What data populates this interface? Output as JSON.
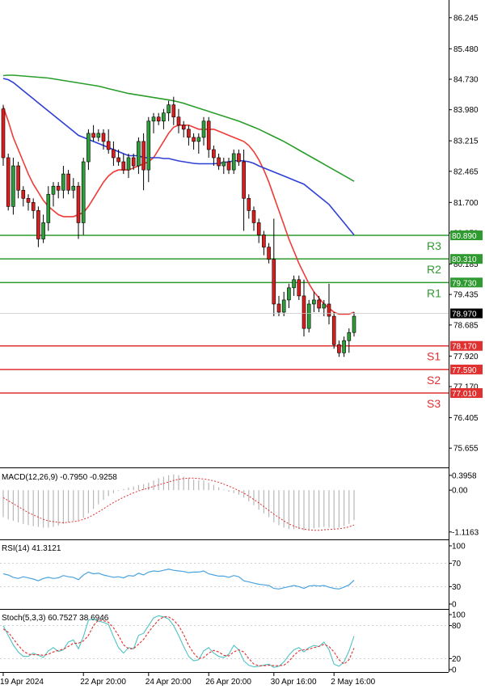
{
  "colors": {
    "candle": "#000000",
    "up_fill": "#2e9e3a",
    "down_fill": "#d81f1f",
    "sma_fast": "#ef3b36",
    "sma_mid": "#2f3fd6",
    "sma_slow": "#2a9d2a",
    "resistance": "#2f9a2f",
    "support": "#e03030",
    "price_box": "#000000",
    "macd_hist": "#b8b8b8",
    "macd_signal": "#e03030",
    "rsi_line": "#4aa3df",
    "stoch_main": "#4fc3c3",
    "stoch_signal": "#e03030"
  },
  "chart_data": [
    {
      "type": "candlestick",
      "title": "",
      "ylim": [
        75.3,
        86.6
      ],
      "y_ticks": [
        "86.245",
        "85.480",
        "84.730",
        "83.980",
        "83.215",
        "82.465",
        "81.700",
        "80.950",
        "80.185",
        "79.435",
        "78.685",
        "77.920",
        "77.170",
        "76.405",
        "75.655"
      ],
      "x_tick_labels": [
        "19 Apr 2024",
        "22 Apr 20:00",
        "24 Apr 20:00",
        "26 Apr 20:00",
        "30 Apr 16:00",
        "2 May 16:00"
      ],
      "x_tick_index": [
        0,
        16,
        29,
        41,
        54,
        66
      ],
      "current_price": "78.970",
      "candles": [
        {
          "o": 84.0,
          "h": 84.1,
          "l": 82.6,
          "c": 82.8
        },
        {
          "o": 82.8,
          "h": 82.9,
          "l": 81.5,
          "c": 81.6
        },
        {
          "o": 81.6,
          "h": 82.8,
          "l": 81.4,
          "c": 82.6
        },
        {
          "o": 82.6,
          "h": 82.7,
          "l": 81.8,
          "c": 82.0
        },
        {
          "o": 82.0,
          "h": 82.1,
          "l": 81.6,
          "c": 81.8
        },
        {
          "o": 81.8,
          "h": 81.9,
          "l": 81.5,
          "c": 81.7
        },
        {
          "o": 81.7,
          "h": 81.8,
          "l": 81.3,
          "c": 81.5
        },
        {
          "o": 81.5,
          "h": 81.6,
          "l": 80.6,
          "c": 80.8
        },
        {
          "o": 80.8,
          "h": 81.4,
          "l": 80.7,
          "c": 81.2
        },
        {
          "o": 81.2,
          "h": 82.1,
          "l": 81.0,
          "c": 81.9
        },
        {
          "o": 81.9,
          "h": 82.2,
          "l": 81.6,
          "c": 82.1
        },
        {
          "o": 82.1,
          "h": 82.2,
          "l": 81.8,
          "c": 82.0
        },
        {
          "o": 82.0,
          "h": 82.6,
          "l": 81.8,
          "c": 82.4
        },
        {
          "o": 82.4,
          "h": 82.5,
          "l": 81.9,
          "c": 82.0
        },
        {
          "o": 82.0,
          "h": 82.3,
          "l": 81.8,
          "c": 82.1
        },
        {
          "o": 82.1,
          "h": 82.2,
          "l": 80.8,
          "c": 81.2
        },
        {
          "o": 81.2,
          "h": 82.8,
          "l": 80.9,
          "c": 82.7
        },
        {
          "o": 82.7,
          "h": 83.5,
          "l": 82.5,
          "c": 83.4
        },
        {
          "o": 83.4,
          "h": 83.6,
          "l": 83.2,
          "c": 83.3
        },
        {
          "o": 83.3,
          "h": 83.5,
          "l": 83.2,
          "c": 83.4
        },
        {
          "o": 83.4,
          "h": 83.5,
          "l": 83.0,
          "c": 83.2
        },
        {
          "o": 83.2,
          "h": 83.5,
          "l": 82.9,
          "c": 83.0
        },
        {
          "o": 83.0,
          "h": 83.2,
          "l": 82.6,
          "c": 82.8
        },
        {
          "o": 82.8,
          "h": 83.0,
          "l": 82.6,
          "c": 82.7
        },
        {
          "o": 82.7,
          "h": 82.9,
          "l": 82.4,
          "c": 82.5
        },
        {
          "o": 82.5,
          "h": 82.9,
          "l": 82.3,
          "c": 82.8
        },
        {
          "o": 82.8,
          "h": 82.9,
          "l": 82.5,
          "c": 82.6
        },
        {
          "o": 82.6,
          "h": 83.3,
          "l": 82.4,
          "c": 83.2
        },
        {
          "o": 83.2,
          "h": 83.4,
          "l": 82.0,
          "c": 82.5
        },
        {
          "o": 82.5,
          "h": 83.8,
          "l": 82.2,
          "c": 83.7
        },
        {
          "o": 83.7,
          "h": 83.9,
          "l": 83.4,
          "c": 83.8
        },
        {
          "o": 83.8,
          "h": 83.9,
          "l": 83.6,
          "c": 83.7
        },
        {
          "o": 83.7,
          "h": 84.0,
          "l": 83.5,
          "c": 83.9
        },
        {
          "o": 83.9,
          "h": 84.2,
          "l": 83.7,
          "c": 84.1
        },
        {
          "o": 84.1,
          "h": 84.3,
          "l": 83.6,
          "c": 83.8
        },
        {
          "o": 83.8,
          "h": 84.0,
          "l": 83.4,
          "c": 83.6
        },
        {
          "o": 83.6,
          "h": 83.7,
          "l": 83.3,
          "c": 83.5
        },
        {
          "o": 83.5,
          "h": 83.6,
          "l": 83.1,
          "c": 83.3
        },
        {
          "o": 83.3,
          "h": 83.4,
          "l": 83.0,
          "c": 83.2
        },
        {
          "o": 83.2,
          "h": 83.4,
          "l": 82.9,
          "c": 83.3
        },
        {
          "o": 83.3,
          "h": 83.8,
          "l": 83.1,
          "c": 83.7
        },
        {
          "o": 83.7,
          "h": 83.8,
          "l": 82.8,
          "c": 83.0
        },
        {
          "o": 83.0,
          "h": 83.1,
          "l": 82.6,
          "c": 82.8
        },
        {
          "o": 82.8,
          "h": 82.9,
          "l": 82.5,
          "c": 82.6
        },
        {
          "o": 82.6,
          "h": 82.8,
          "l": 82.4,
          "c": 82.7
        },
        {
          "o": 82.7,
          "h": 82.8,
          "l": 82.4,
          "c": 82.5
        },
        {
          "o": 82.5,
          "h": 83.0,
          "l": 82.4,
          "c": 82.9
        },
        {
          "o": 82.9,
          "h": 83.0,
          "l": 82.6,
          "c": 82.7
        },
        {
          "o": 82.7,
          "h": 83.0,
          "l": 81.0,
          "c": 81.8
        },
        {
          "o": 81.8,
          "h": 81.9,
          "l": 81.3,
          "c": 81.5
        },
        {
          "o": 81.5,
          "h": 81.6,
          "l": 81.0,
          "c": 81.2
        },
        {
          "o": 81.2,
          "h": 81.3,
          "l": 80.7,
          "c": 80.9
        },
        {
          "o": 80.9,
          "h": 81.0,
          "l": 80.4,
          "c": 80.6
        },
        {
          "o": 80.6,
          "h": 80.7,
          "l": 80.2,
          "c": 80.3
        },
        {
          "o": 80.3,
          "h": 81.3,
          "l": 78.9,
          "c": 79.2
        },
        {
          "o": 79.2,
          "h": 79.4,
          "l": 78.9,
          "c": 79.0
        },
        {
          "o": 79.0,
          "h": 79.5,
          "l": 78.9,
          "c": 79.3
        },
        {
          "o": 79.3,
          "h": 79.7,
          "l": 79.1,
          "c": 79.6
        },
        {
          "o": 79.6,
          "h": 79.9,
          "l": 79.4,
          "c": 79.8
        },
        {
          "o": 79.8,
          "h": 79.9,
          "l": 79.3,
          "c": 79.4
        },
        {
          "o": 79.4,
          "h": 79.8,
          "l": 78.4,
          "c": 78.6
        },
        {
          "o": 78.6,
          "h": 79.3,
          "l": 78.5,
          "c": 79.2
        },
        {
          "o": 79.2,
          "h": 79.5,
          "l": 79.0,
          "c": 79.3
        },
        {
          "o": 79.3,
          "h": 79.4,
          "l": 79.0,
          "c": 79.1
        },
        {
          "o": 79.1,
          "h": 79.3,
          "l": 78.9,
          "c": 79.2
        },
        {
          "o": 79.2,
          "h": 79.7,
          "l": 78.7,
          "c": 78.9
        },
        {
          "o": 78.9,
          "h": 79.0,
          "l": 78.1,
          "c": 78.2
        },
        {
          "o": 78.2,
          "h": 78.3,
          "l": 77.9,
          "c": 78.0
        },
        {
          "o": 78.0,
          "h": 78.4,
          "l": 77.9,
          "c": 78.3
        },
        {
          "o": 78.3,
          "h": 78.6,
          "l": 78.0,
          "c": 78.5
        },
        {
          "o": 78.5,
          "h": 79.0,
          "l": 78.4,
          "c": 78.9
        }
      ],
      "series": [
        {
          "values": [
            84.05,
            83.7,
            83.3,
            83.0,
            82.7,
            82.4,
            82.15,
            81.95,
            81.75,
            81.6,
            81.5,
            81.4,
            81.35,
            81.35,
            81.35,
            81.4,
            81.45,
            81.6,
            81.8,
            82.0,
            82.2,
            82.35,
            82.45,
            82.5,
            82.5,
            82.5,
            82.55,
            82.6,
            82.65,
            82.7,
            82.8,
            83.0,
            83.2,
            83.4,
            83.55,
            83.6,
            83.6,
            83.6,
            83.55,
            83.5,
            83.5,
            83.5,
            83.5,
            83.45,
            83.4,
            83.35,
            83.3,
            83.25,
            83.2,
            83.1,
            82.95,
            82.75,
            82.5,
            82.2,
            81.85,
            81.5,
            81.15,
            80.8,
            80.5,
            80.2,
            79.95,
            79.7,
            79.5,
            79.35,
            79.2,
            79.1,
            79.0,
            78.95,
            78.95,
            78.95,
            79.0
          ]
        },
        {
          "values": [
            84.75,
            84.72,
            84.65,
            84.55,
            84.45,
            84.35,
            84.25,
            84.15,
            84.05,
            83.95,
            83.85,
            83.75,
            83.65,
            83.55,
            83.45,
            83.35,
            83.3,
            83.25,
            83.2,
            83.15,
            83.1,
            83.05,
            83.0,
            82.95,
            82.9,
            82.85,
            82.85,
            82.85,
            82.8,
            82.8,
            82.8,
            82.8,
            82.78,
            82.78,
            82.75,
            82.72,
            82.7,
            82.68,
            82.66,
            82.65,
            82.65,
            82.65,
            82.65,
            82.66,
            82.68,
            82.7,
            82.72,
            82.73,
            82.72,
            82.7,
            82.66,
            82.6,
            82.55,
            82.5,
            82.45,
            82.4,
            82.35,
            82.3,
            82.25,
            82.2,
            82.15,
            82.05,
            81.95,
            81.85,
            81.75,
            81.65,
            81.5,
            81.35,
            81.2,
            81.05,
            80.9
          ]
        },
        {
          "values": [
            84.82,
            84.83,
            84.83,
            84.82,
            84.81,
            84.8,
            84.79,
            84.78,
            84.77,
            84.76,
            84.74,
            84.72,
            84.7,
            84.68,
            84.66,
            84.64,
            84.62,
            84.6,
            84.58,
            84.56,
            84.53,
            84.5,
            84.47,
            84.44,
            84.41,
            84.38,
            84.36,
            84.34,
            84.32,
            84.3,
            84.28,
            84.26,
            84.24,
            84.22,
            84.2,
            84.17,
            84.14,
            84.1,
            84.06,
            84.02,
            83.98,
            83.94,
            83.9,
            83.86,
            83.82,
            83.78,
            83.74,
            83.7,
            83.65,
            83.6,
            83.55,
            83.5,
            83.44,
            83.38,
            83.32,
            83.26,
            83.2,
            83.13,
            83.06,
            82.99,
            82.92,
            82.85,
            82.78,
            82.71,
            82.64,
            82.57,
            82.5,
            82.43,
            82.36,
            82.29,
            82.22
          ]
        }
      ],
      "levels": [
        {
          "label": "R3",
          "value": 80.89,
          "value_label": "80.890",
          "kind": "resistance"
        },
        {
          "label": "R2",
          "value": 80.31,
          "value_label": "80.310",
          "kind": "resistance"
        },
        {
          "label": "R1",
          "value": 79.73,
          "value_label": "79.730",
          "kind": "resistance"
        },
        {
          "label": "S1",
          "value": 78.17,
          "value_label": "78.170",
          "kind": "support"
        },
        {
          "label": "S2",
          "value": 77.59,
          "value_label": "77.590",
          "kind": "support"
        },
        {
          "label": "S3",
          "value": 77.01,
          "value_label": "77.010",
          "kind": "support"
        }
      ]
    },
    {
      "type": "bar",
      "title": "MACD(12,26,9) -0.7950 -0.9258",
      "ylim": [
        -1.25,
        0.5
      ],
      "y_ticks": [
        "0.3958",
        "0.00",
        "-1.1163"
      ],
      "y_tick_values": [
        0.3958,
        0.0,
        -1.1163
      ],
      "histogram": [
        -0.72,
        -0.78,
        -0.82,
        -0.86,
        -0.9,
        -0.93,
        -0.96,
        -0.98,
        -1.0,
        -1.0,
        -0.98,
        -0.95,
        -0.9,
        -0.86,
        -0.82,
        -0.8,
        -0.74,
        -0.62,
        -0.5,
        -0.38,
        -0.26,
        -0.16,
        -0.08,
        -0.02,
        0.03,
        0.07,
        0.1,
        0.14,
        0.16,
        0.2,
        0.26,
        0.32,
        0.36,
        0.4,
        0.42,
        0.4,
        0.36,
        0.32,
        0.28,
        0.26,
        0.26,
        0.2,
        0.14,
        0.08,
        0.02,
        -0.04,
        -0.08,
        -0.12,
        -0.2,
        -0.3,
        -0.4,
        -0.52,
        -0.62,
        -0.72,
        -0.86,
        -0.94,
        -1.0,
        -1.04,
        -1.04,
        -1.04,
        -1.08,
        -1.04,
        -1.02,
        -1.0,
        -0.98,
        -1.0,
        -1.02,
        -1.0,
        -0.96,
        -0.9,
        -0.8
      ],
      "signal": [
        -0.2,
        -0.28,
        -0.36,
        -0.44,
        -0.52,
        -0.6,
        -0.66,
        -0.72,
        -0.78,
        -0.82,
        -0.84,
        -0.86,
        -0.87,
        -0.86,
        -0.84,
        -0.82,
        -0.78,
        -0.73,
        -0.66,
        -0.58,
        -0.5,
        -0.41,
        -0.33,
        -0.26,
        -0.19,
        -0.13,
        -0.07,
        -0.02,
        0.02,
        0.06,
        0.1,
        0.14,
        0.18,
        0.22,
        0.26,
        0.29,
        0.31,
        0.32,
        0.32,
        0.31,
        0.3,
        0.28,
        0.25,
        0.21,
        0.16,
        0.11,
        0.05,
        -0.01,
        -0.08,
        -0.16,
        -0.25,
        -0.34,
        -0.44,
        -0.54,
        -0.64,
        -0.73,
        -0.82,
        -0.9,
        -0.96,
        -1.01,
        -1.04,
        -1.06,
        -1.07,
        -1.07,
        -1.06,
        -1.05,
        -1.04,
        -1.03,
        -1.01,
        -0.98,
        -0.93
      ]
    },
    {
      "type": "line",
      "title": "RSI(14) 41.3121",
      "ylim": [
        0,
        100
      ],
      "y_ticks": [
        "100",
        "70",
        "30",
        "0"
      ],
      "y_tick_values": [
        100,
        70,
        30,
        0
      ],
      "values": [
        52,
        50,
        46,
        44,
        47,
        45,
        43,
        40,
        44,
        46,
        44,
        45,
        49,
        47,
        46,
        42,
        50,
        55,
        52,
        53,
        50,
        48,
        46,
        47,
        45,
        49,
        48,
        53,
        50,
        55,
        57,
        56,
        58,
        60,
        58,
        57,
        56,
        54,
        55,
        55,
        57,
        52,
        50,
        48,
        48,
        46,
        49,
        47,
        40,
        38,
        36,
        34,
        33,
        32,
        27,
        26,
        28,
        30,
        32,
        30,
        27,
        31,
        32,
        31,
        32,
        29,
        27,
        26,
        29,
        33,
        41
      ]
    },
    {
      "type": "line",
      "title": "Stoch(5,3,3) 60.7527 38.6946",
      "ylim": [
        0,
        100
      ],
      "y_ticks": [
        "100",
        "80",
        "20",
        "0"
      ],
      "y_tick_values": [
        100,
        80,
        20,
        0
      ],
      "series": [
        {
          "values": [
            80,
            62,
            45,
            32,
            24,
            24,
            30,
            26,
            22,
            34,
            40,
            33,
            36,
            50,
            54,
            38,
            60,
            90,
            92,
            88,
            86,
            82,
            60,
            40,
            30,
            40,
            38,
            62,
            66,
            80,
            94,
            98,
            96,
            92,
            80,
            62,
            42,
            24,
            16,
            18,
            34,
            40,
            30,
            24,
            22,
            28,
            44,
            36,
            16,
            8,
            5,
            6,
            8,
            10,
            4,
            6,
            14,
            26,
            36,
            40,
            32,
            40,
            44,
            42,
            50,
            36,
            10,
            6,
            14,
            34,
            61
          ]
        },
        {
          "values": [
            74,
            68,
            56,
            44,
            34,
            28,
            27,
            27,
            26,
            28,
            32,
            35,
            37,
            42,
            48,
            48,
            52,
            62,
            80,
            90,
            89,
            86,
            76,
            62,
            45,
            38,
            38,
            46,
            55,
            68,
            80,
            90,
            96,
            96,
            90,
            80,
            64,
            44,
            30,
            20,
            22,
            30,
            35,
            32,
            26,
            25,
            32,
            36,
            32,
            20,
            10,
            7,
            7,
            8,
            7,
            7,
            8,
            15,
            26,
            34,
            36,
            37,
            40,
            42,
            46,
            42,
            32,
            18,
            10,
            18,
            39
          ]
        }
      ]
    }
  ]
}
